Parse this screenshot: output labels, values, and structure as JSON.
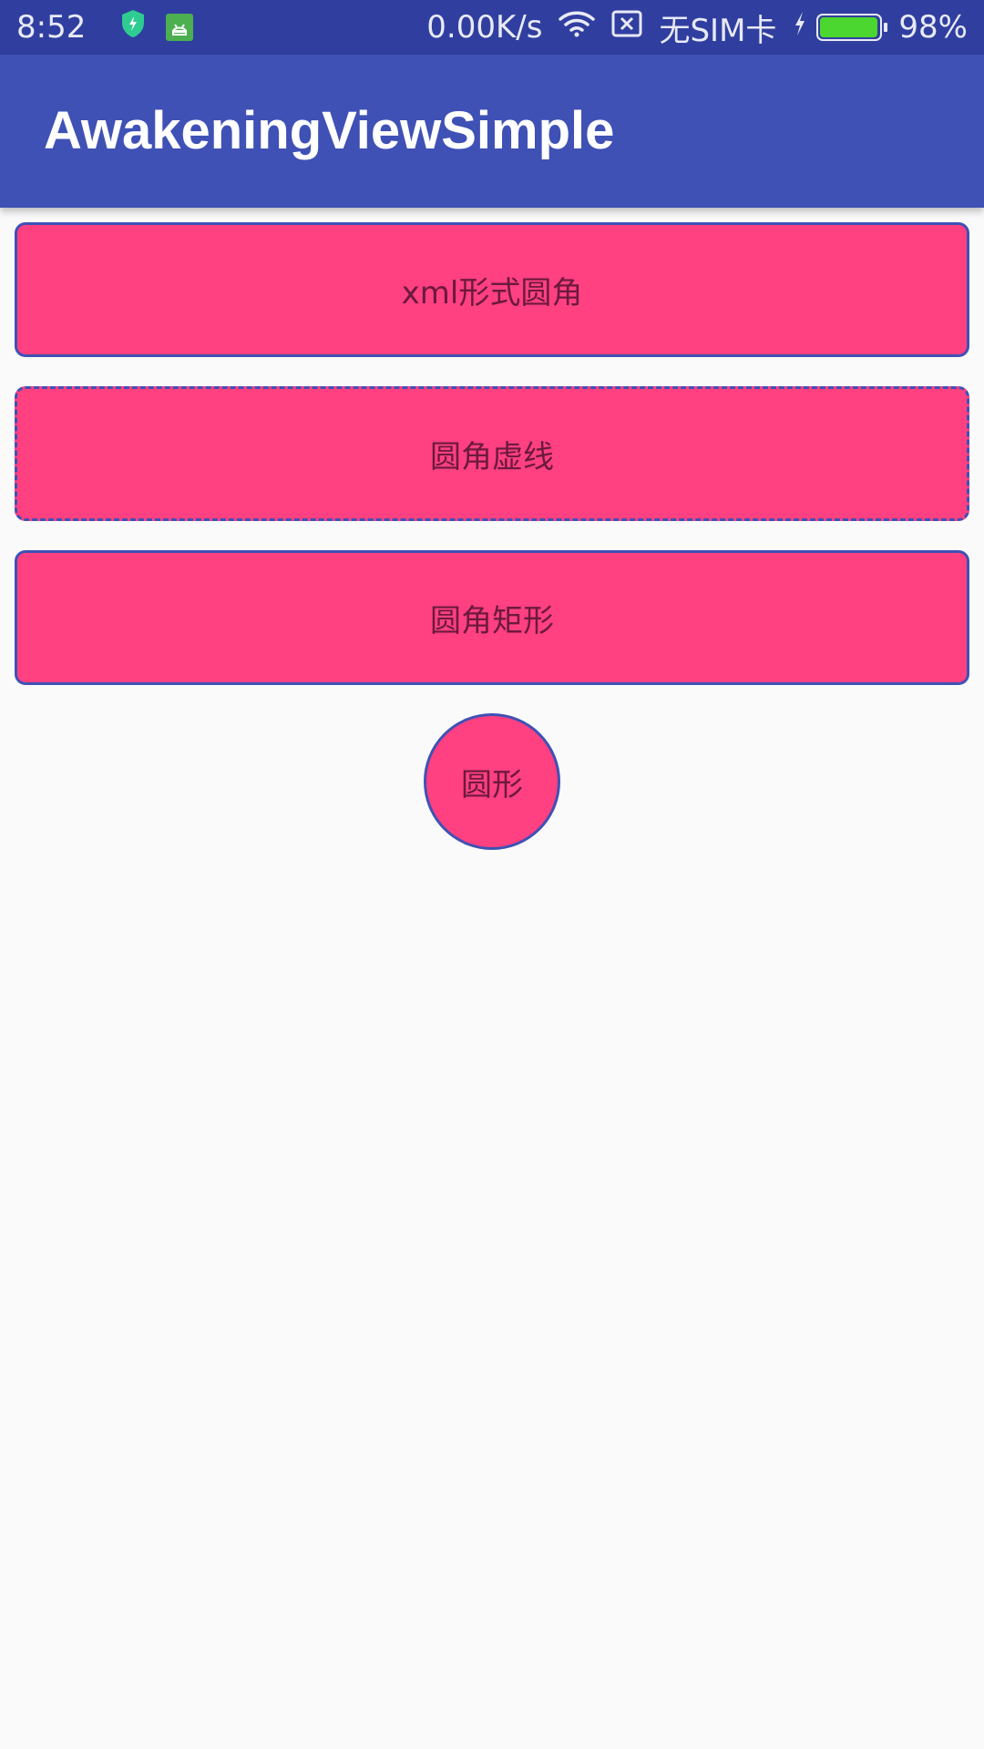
{
  "status_bar": {
    "time": "8:52",
    "network_speed": "0.00K/s",
    "sim_status": "无SIM卡",
    "battery_percent": "98%",
    "battery_level": 0.98,
    "icons": [
      "shield-icon",
      "android-icon",
      "wifi-icon",
      "sim-icon",
      "charging-icon",
      "battery-icon"
    ]
  },
  "app_bar": {
    "title": "AwakeningViewSimple"
  },
  "buttons": {
    "xml_rounded": "xml形式圆角",
    "rounded_dashed": "圆角虚线",
    "rounded_rect": "圆角矩形",
    "circle": "圆形"
  },
  "colors": {
    "status_bar": "#303f9f",
    "primary": "#3f51b5",
    "accent": "#ff4081",
    "background": "#fafafa"
  }
}
